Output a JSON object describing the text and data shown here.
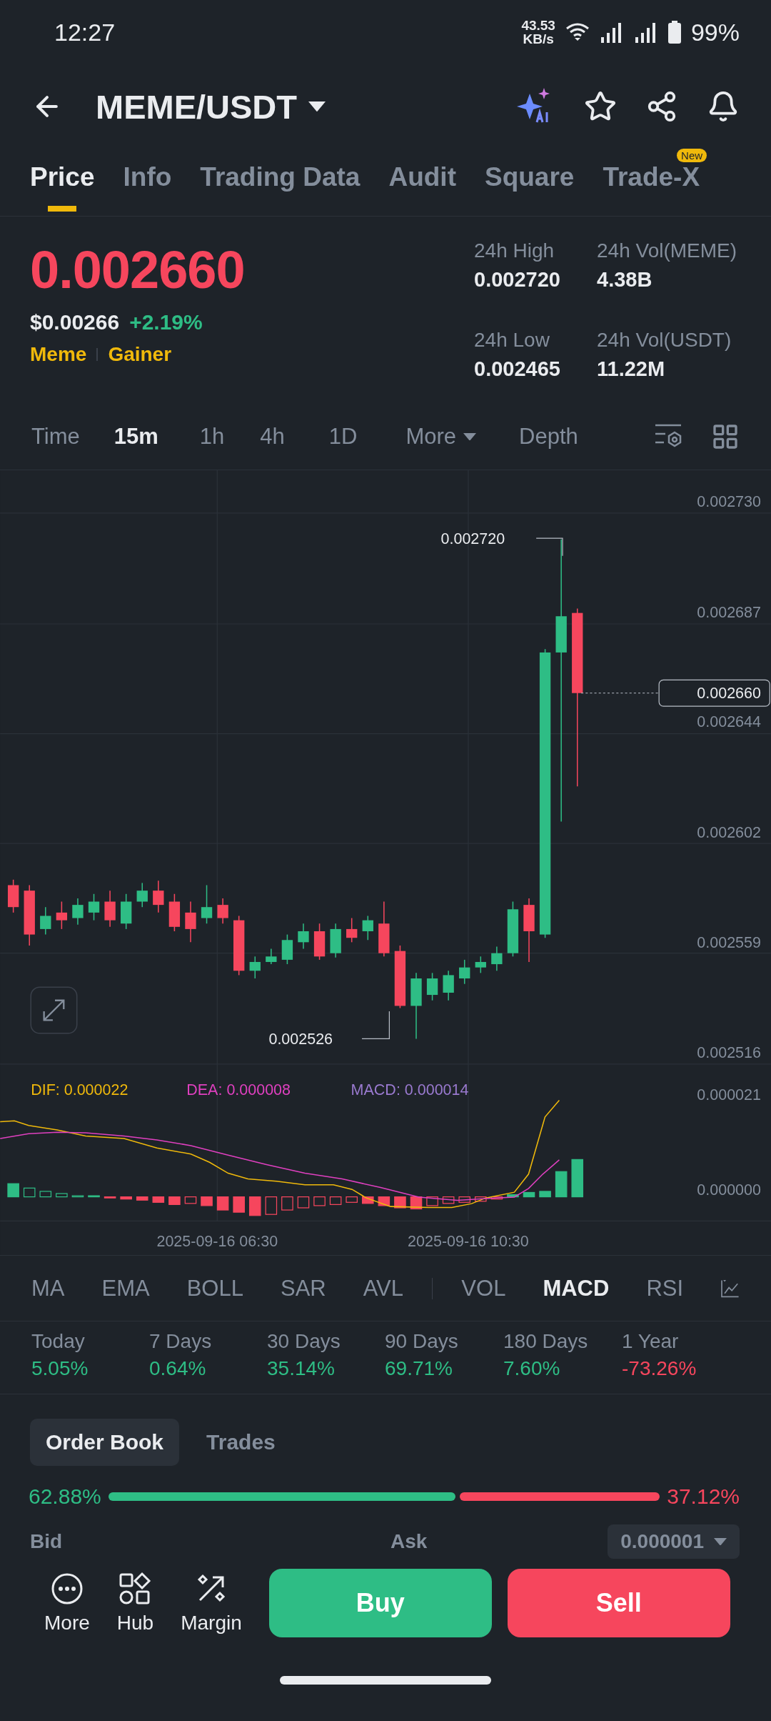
{
  "status_bar": {
    "time": "12:27",
    "net_speed": [
      "43.53",
      "KB/s"
    ],
    "battery": "99%"
  },
  "header": {
    "pair": "MEME/USDT"
  },
  "tabs": [
    {
      "label": "Price",
      "selected": true
    },
    {
      "label": "Info",
      "selected": false
    },
    {
      "label": "Trading Data",
      "selected": false
    },
    {
      "label": "Audit",
      "selected": false
    },
    {
      "label": "Square",
      "selected": false
    },
    {
      "label": "Trade-X",
      "selected": false,
      "badge": "New"
    }
  ],
  "ticker": {
    "price": "0.002660",
    "usd_price": "$0.00266",
    "change": "+2.19%",
    "tags": [
      "Meme",
      "Gainer"
    ],
    "stats": [
      {
        "label": "24h High",
        "value": "0.002720"
      },
      {
        "label": "24h Vol(MEME)",
        "value": "4.38B"
      },
      {
        "label": "24h Low",
        "value": "0.002465"
      },
      {
        "label": "24h Vol(USDT)",
        "value": "11.22M"
      }
    ]
  },
  "intervals": [
    {
      "label": "Time",
      "selected": false,
      "dropdown": false
    },
    {
      "label": "15m",
      "selected": true,
      "dropdown": false
    },
    {
      "label": "1h",
      "selected": false,
      "dropdown": false
    },
    {
      "label": "4h",
      "selected": false,
      "dropdown": false
    },
    {
      "label": "1D",
      "selected": false,
      "dropdown": false
    },
    {
      "label": "More",
      "selected": false,
      "dropdown": true
    },
    {
      "label": "Depth",
      "selected": false,
      "dropdown": false
    }
  ],
  "chart": {
    "price_labels": [
      "0.002730",
      "0.002687",
      "0.002644",
      "0.002602",
      "0.002559",
      "0.002516"
    ],
    "high_marker": "0.002720",
    "low_marker": "0.002526",
    "current_price": "0.002660",
    "macd_legend": [
      {
        "label": "DIF: 0.000022",
        "color": "#f0b90b"
      },
      {
        "label": "DEA: 0.000008",
        "color": "#e040c0"
      },
      {
        "label": "MACD: 0.000014",
        "color": "#9a7ad0"
      }
    ],
    "macd_labels": [
      "0.000021",
      "0.000000"
    ],
    "time_labels": [
      "2025-09-16 06:30",
      "2025-09-16 10:30"
    ]
  },
  "indicators": [
    {
      "label": "MA",
      "selected": false,
      "kind": "tab"
    },
    {
      "label": "EMA",
      "selected": false,
      "kind": "tab"
    },
    {
      "label": "BOLL",
      "selected": false,
      "kind": "tab"
    },
    {
      "label": "SAR",
      "selected": false,
      "kind": "tab"
    },
    {
      "label": "AVL",
      "selected": false,
      "kind": "tab"
    },
    {
      "kind": "divider"
    },
    {
      "label": "VOL",
      "selected": false,
      "kind": "tab"
    },
    {
      "label": "MACD",
      "selected": true,
      "kind": "tab"
    },
    {
      "label": "RSI",
      "selected": false,
      "kind": "tab"
    }
  ],
  "performance": [
    {
      "label": "Today",
      "value": "5.05%",
      "color": "#2ebd85"
    },
    {
      "label": "7 Days",
      "value": "0.64%",
      "color": "#2ebd85"
    },
    {
      "label": "30 Days",
      "value": "35.14%",
      "color": "#2ebd85"
    },
    {
      "label": "90 Days",
      "value": "69.71%",
      "color": "#2ebd85"
    },
    {
      "label": "180 Days",
      "value": "7.60%",
      "color": "#2ebd85"
    },
    {
      "label": "1 Year",
      "value": "-73.26%",
      "color": "#f6465d"
    }
  ],
  "order_book": {
    "tabs": [
      {
        "label": "Order Book",
        "selected": true
      },
      {
        "label": "Trades",
        "selected": false
      }
    ],
    "bid_percent": "62.88%",
    "ask_percent": "37.12%",
    "bid_label": "Bid",
    "ask_label": "Ask",
    "precision": "0.000001"
  },
  "actions": [
    {
      "label": "More",
      "kind": "more"
    },
    {
      "label": "Hub",
      "kind": "hub"
    },
    {
      "label": "Margin",
      "kind": "margin"
    }
  ],
  "trade_buttons": [
    {
      "label": "Buy",
      "kind": "buy"
    },
    {
      "label": "Sell",
      "kind": "sell"
    }
  ]
}
